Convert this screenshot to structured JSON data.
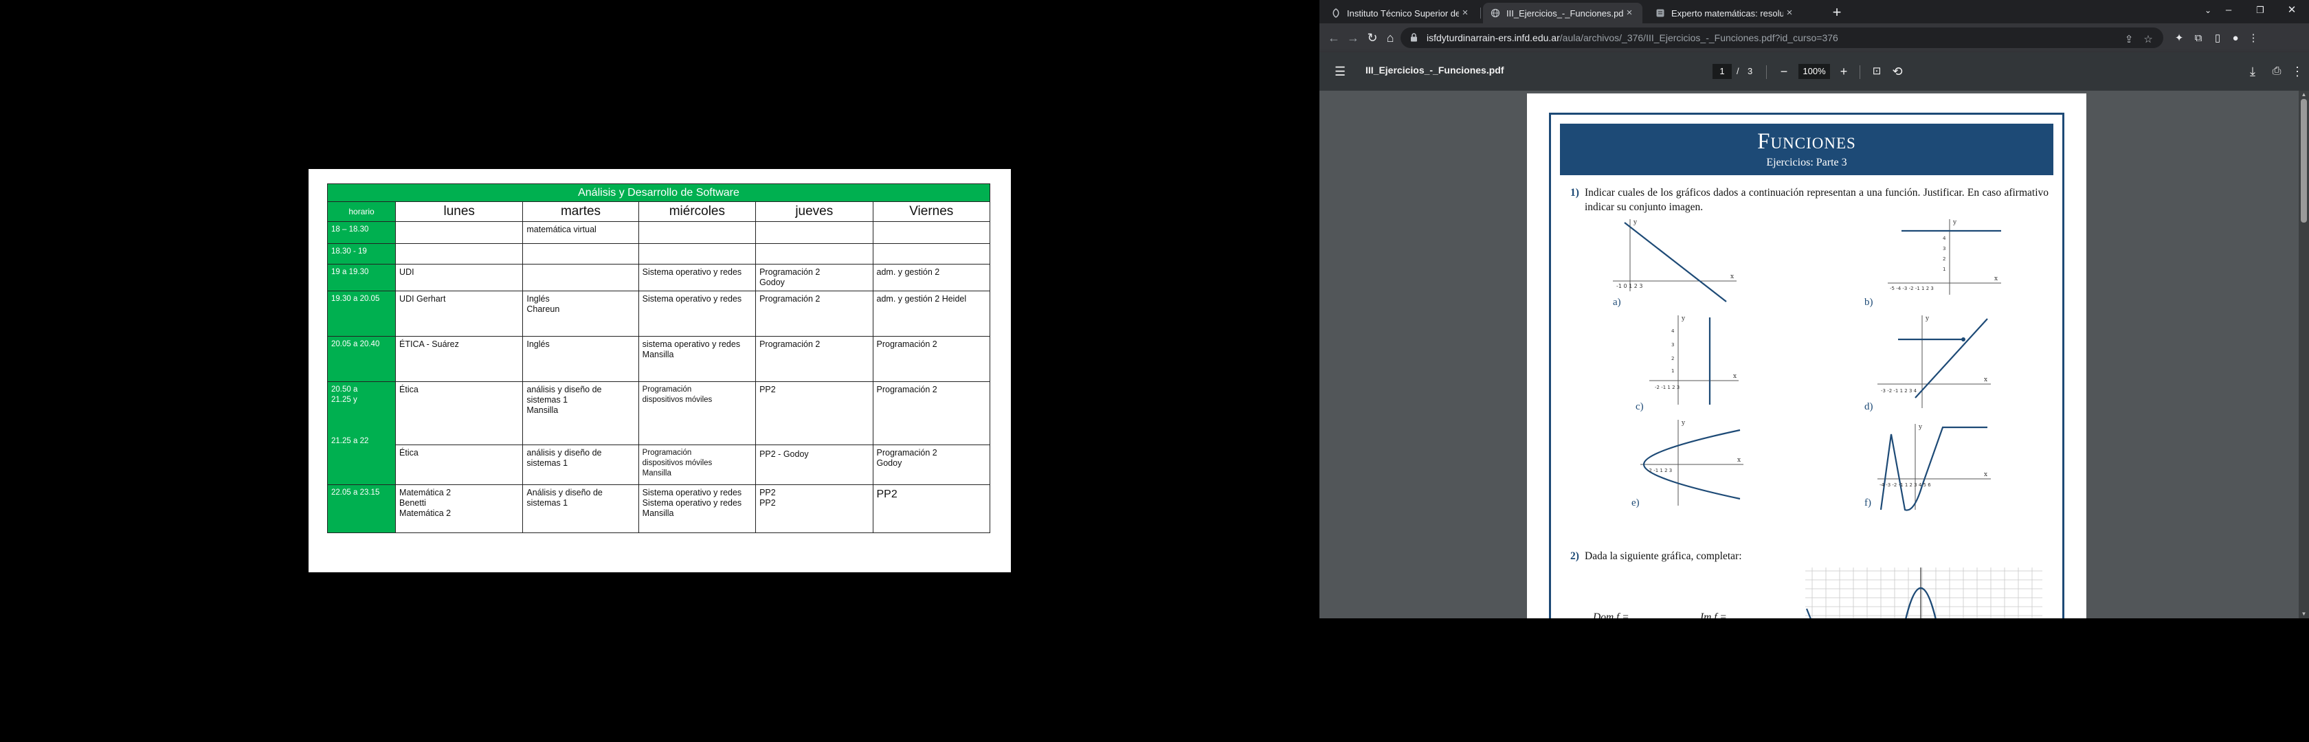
{
  "schedule": {
    "title": "Análisis y Desarrollo de Software",
    "hour_header": "horario",
    "days": [
      "lunes",
      "martes",
      "miércoles",
      "jueves",
      "Viernes"
    ],
    "rows": [
      {
        "hour": [
          "18 – 18.30"
        ],
        "cells": [
          [],
          [
            "matemática virtual"
          ],
          [],
          [],
          []
        ]
      },
      {
        "hour": [
          "18.30 - 19"
        ],
        "cells": [
          [],
          [],
          [],
          [],
          []
        ]
      },
      {
        "hour": [
          "19 a 19.30"
        ],
        "cells": [
          [
            "UDI"
          ],
          [],
          [
            "Sistema operativo y redes"
          ],
          [
            "Programación 2",
            "Godoy"
          ],
          [
            "adm. y gestión 2"
          ]
        ]
      },
      {
        "hour": [
          "19.30 a 20.05"
        ],
        "cells": [
          [
            "UDI Gerhart"
          ],
          [
            "Inglés",
            "Chareun"
          ],
          [
            "Sistema operativo y redes"
          ],
          [
            "Programación 2"
          ],
          [
            "adm. y gestión 2 Heidel"
          ]
        ]
      },
      {
        "hour": [
          "20.05 a 20.40"
        ],
        "cells": [
          [
            "ÉTICA - Suárez"
          ],
          [
            "Inglés"
          ],
          [
            "sistema operativo y redes",
            "Mansilla"
          ],
          [
            "Programación 2"
          ],
          [
            "Programación 2"
          ]
        ]
      },
      {
        "hour": [
          "20.50 a",
          "21.25 y",
          "",
          "",
          "",
          "21.25 a 22"
        ],
        "cells": [
          [
            "Ética"
          ],
          [
            "análisis y diseño de",
            "sistemas 1",
            "Mansilla"
          ],
          [
            "Programación",
            "dispositivos móviles"
          ],
          [
            "PP2"
          ],
          [
            "Programación 2"
          ]
        ]
      },
      {
        "hour": [],
        "cells": [
          [
            "Ética"
          ],
          [
            "análisis y diseño de",
            "sistemas 1"
          ],
          [
            "Programación",
            "dispositivos móviles",
            "Mansilla"
          ],
          [
            "PP2 - Godoy"
          ],
          [
            "Programación 2",
            "Godoy"
          ]
        ]
      },
      {
        "hour": [
          "22.05 a 23.15"
        ],
        "cells": [
          [
            "Matemática 2",
            "Benetti",
            "Matemática 2"
          ],
          [
            "Análisis y diseño de",
            "sistemas 1"
          ],
          [
            "Sistema operativo y redes",
            "Sistema operativo y redes",
            "Mansilla"
          ],
          [
            "PP2",
            "PP2"
          ],
          [
            "PP2"
          ]
        ]
      }
    ]
  },
  "browser": {
    "tabs": [
      {
        "label": "Instituto Técnico Superior de Urquiza",
        "active": false
      },
      {
        "label": "III_Ejercicios_-_Funciones.pdf",
        "active": true
      },
      {
        "label": "Experto matemáticas: resolución",
        "active": false
      }
    ],
    "new_tab": "+",
    "url_host": "isfdyturdinarrain-ers.infd.edu.ar",
    "url_path": "/aula/archivos/_376/III_Ejercicios_-_Funciones.pdf?id_curso=376",
    "pdf": {
      "filename": "III_Ejercicios_-_Funciones.pdf",
      "current_page": "1",
      "page_separator": "/",
      "total_pages": "3",
      "zoom": "100%",
      "title": "Funciones",
      "subtitle": "Ejercicios: Parte 3",
      "q1_number": "1)",
      "q1_text": "Indicar cuales de los gráficos dados a continuación representan a una función. Justificar. En caso afirmativo indicar su conjunto imagen.",
      "graph_labels": [
        "a)",
        "b)",
        "c)",
        "d)",
        "e)",
        "f)"
      ],
      "q2_number": "2)",
      "q2_text": "Dada la siguiente gráfica, completar:",
      "q2_dom": "Dom f =",
      "q2_im": "Im f ="
    }
  },
  "colors": {
    "schedule_green": "#00b050",
    "pdf_header_blue": "#1d4a76",
    "graph_blue": "#1d4a76"
  }
}
